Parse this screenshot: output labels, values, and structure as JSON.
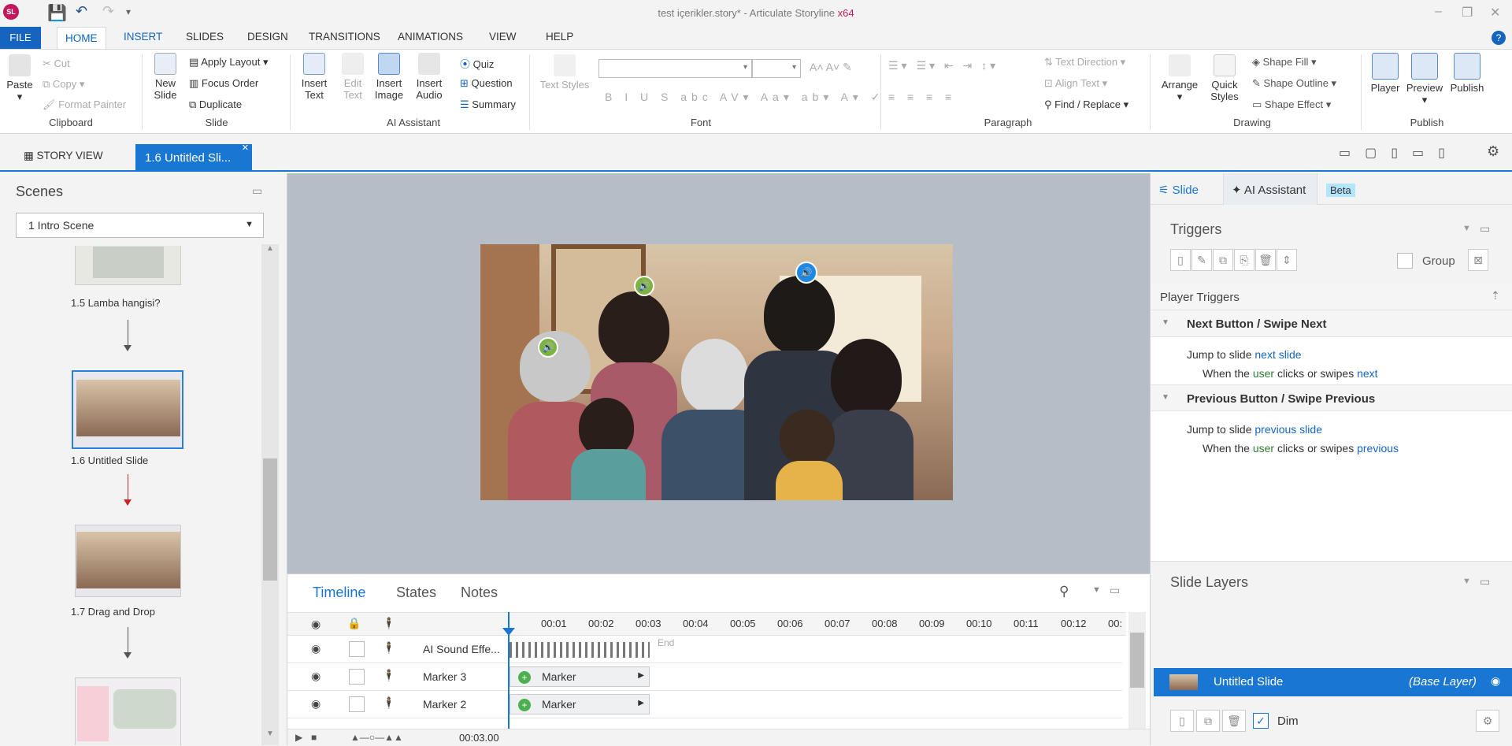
{
  "window": {
    "title_main": "test içerikler.story* -  Articulate Storyline",
    "title_arch": "x64",
    "logo": "SL"
  },
  "ribbon_tabs": [
    "FILE",
    "HOME",
    "INSERT",
    "SLIDES",
    "DESIGN",
    "TRANSITIONS",
    "ANIMATIONS",
    "VIEW",
    "HELP"
  ],
  "ribbon": {
    "clipboard": {
      "paste": "Paste",
      "cut": "Cut",
      "copy": "Copy",
      "format_painter": "Format Painter",
      "label": "Clipboard"
    },
    "slide": {
      "new_slide": "New Slide",
      "apply_layout": "Apply Layout",
      "focus_order": "Focus Order",
      "duplicate": "Duplicate",
      "label": "Slide"
    },
    "ai": {
      "insert_text": "Insert Text",
      "edit_text": "Edit Text",
      "insert_image": "Insert Image",
      "insert_audio": "Insert Audio",
      "quiz": "Quiz",
      "question": "Question",
      "summary": "Summary",
      "label": "AI Assistant"
    },
    "font": {
      "text_styles": "Text Styles",
      "label": "Font"
    },
    "paragraph": {
      "text_direction": "Text Direction",
      "align_text": "Align Text",
      "find_replace": "Find / Replace",
      "label": "Paragraph"
    },
    "drawing": {
      "arrange": "Arrange",
      "quick_styles": "Quick Styles",
      "shape_fill": "Shape Fill",
      "shape_outline": "Shape Outline",
      "shape_effect": "Shape Effect",
      "label": "Drawing"
    },
    "publish": {
      "player": "Player",
      "preview": "Preview",
      "publish": "Publish",
      "label": "Publish"
    }
  },
  "doc_tabs": {
    "story_view": "STORY VIEW",
    "slide_tab": "1.6 Untitled Sli..."
  },
  "scenes": {
    "title": "Scenes",
    "selected": "1 Intro Scene",
    "slides": [
      {
        "label": "1.5 Lamba hangisi?"
      },
      {
        "label": "1.6 Untitled Slide"
      },
      {
        "label": "1.7 Drag and Drop"
      }
    ]
  },
  "timeline": {
    "tabs": [
      "Timeline",
      "States",
      "Notes"
    ],
    "ticks": [
      "00:01",
      "00:02",
      "00:03",
      "00:04",
      "00:05",
      "00:06",
      "00:07",
      "00:08",
      "00:09",
      "00:10",
      "00:11",
      "00:12",
      "00:"
    ],
    "rows": [
      {
        "name": "AI Sound Effe...",
        "bar": "",
        "end": "End"
      },
      {
        "name": "Marker 3",
        "bar": "Marker"
      },
      {
        "name": "Marker 2",
        "bar": "Marker"
      }
    ],
    "time": "00:03.00"
  },
  "right": {
    "tab_slide": "Slide",
    "tab_ai": "AI Assistant",
    "beta": "Beta",
    "triggers_title": "Triggers",
    "group_label": "Group",
    "player_triggers": "Player Triggers",
    "next": {
      "heading": "Next Button / Swipe Next",
      "t1": "Jump to slide ",
      "t1b": "next slide",
      "t2": "When the ",
      "t2a": "user",
      "t2b": " clicks or swipes ",
      "t2c": "next"
    },
    "prev": {
      "heading": "Previous Button / Swipe Previous",
      "t1": "Jump to slide ",
      "t1b": "previous slide",
      "t2": "When the ",
      "t2a": "user",
      "t2b": " clicks or swipes ",
      "t2c": "previous"
    },
    "layers_title": "Slide Layers",
    "layer_name": "Untitled Slide",
    "layer_type": "(Base Layer)",
    "dim": "Dim"
  },
  "colors": {
    "accent": "#1976d2",
    "brand": "#c2185b"
  }
}
